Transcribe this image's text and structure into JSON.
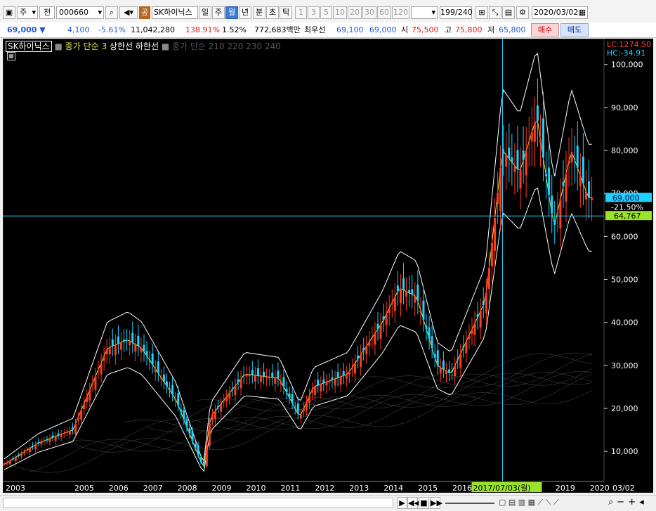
{
  "toolbar": {
    "market": "주",
    "prefix": "전",
    "code": "000660",
    "gong": "공",
    "name": "SK하이닉스",
    "periods": [
      "일",
      "주",
      "월",
      "년"
    ],
    "active_period": "월",
    "periods2": [
      "분",
      "초",
      "틱"
    ],
    "intervals": [
      "1",
      "3",
      "5",
      "10",
      "20",
      "30",
      "60",
      "120"
    ],
    "count": "199/240",
    "date": "2020/03/02"
  },
  "quote": {
    "price": "69,000",
    "change": "4,100",
    "rate": "-5.61%",
    "volume": "11,042,280",
    "vol_ratio": "138.91%",
    "turnover": "1.52%",
    "amount": "772,683백만",
    "priority_label": "최우선",
    "bid1": "69,100",
    "bid2": "69,000",
    "open_label": "시",
    "open": "75,500",
    "high_label": "고",
    "high": "75,800",
    "low_label": "저",
    "low": "65,800",
    "buy": "매수",
    "sell": "매도"
  },
  "legend": {
    "stock": "SK하이닉스",
    "indicator": "종가 단순 3",
    "upper": "상한선",
    "lower": "하한선",
    "ma": "종가 단순 210 220 230 240"
  },
  "chart_data": {
    "type": "candlestick",
    "series": [
      {
        "name": "SK하이닉스",
        "x": [
          2003,
          2004,
          2005,
          2006,
          2006.6,
          2007,
          2008,
          2008.8,
          2009,
          2010,
          2011,
          2011.6,
          2012,
          2013,
          2014,
          2014.5,
          2015,
          2015.6,
          2016,
          2017,
          2017.5,
          2018,
          2018.5,
          2019,
          2019.5,
          2020
        ],
        "close": [
          7000,
          12000,
          15000,
          34000,
          36000,
          34000,
          22000,
          6000,
          18000,
          28000,
          27000,
          18000,
          25000,
          28000,
          40000,
          48000,
          46000,
          30000,
          28000,
          45000,
          80000,
          75000,
          88000,
          62000,
          80000,
          69000
        ]
      }
    ],
    "yticks": [
      "100,000",
      "90,000",
      "80,000",
      "70,000",
      "60,000",
      "50,000",
      "40,000",
      "30,000",
      "20,000",
      "10,000"
    ],
    "ylim": [
      3000,
      106000
    ],
    "xticks": [
      "2003",
      "2005",
      "2006",
      "2007",
      "2008",
      "2009",
      "2010",
      "2011",
      "2012",
      "2013",
      "2014",
      "2015",
      "2016",
      "2018",
      "2019",
      "2020"
    ],
    "right_label": "03/02",
    "crosshair_date": "2017/07/03(월)",
    "crosshair_value": "64,767",
    "last_price_label": "69,000",
    "last_rate_label": "-21.50%",
    "lc_label": "LC:1274.50",
    "hc_label": "HC:-34.91",
    "colors": {
      "up": "#ff3b1f",
      "down": "#1ad3ff",
      "band": "#ffffff"
    }
  }
}
